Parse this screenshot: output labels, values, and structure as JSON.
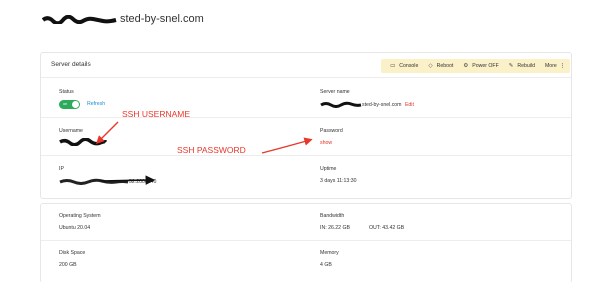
{
  "host": {
    "title_suffix": "sted-by-snel.com"
  },
  "details": {
    "title": "Server details",
    "toolbar": [
      {
        "label": "Console",
        "icon": "console-icon",
        "glyph": "▭"
      },
      {
        "label": "Reboot",
        "icon": "reboot-icon",
        "glyph": "◇"
      },
      {
        "label": "Power OFF",
        "icon": "power-icon",
        "glyph": "⚙"
      },
      {
        "label": "Rebuild",
        "icon": "wrench-icon",
        "glyph": "✎"
      },
      {
        "label": "More",
        "icon": "more-icon",
        "glyph": "⋮"
      }
    ],
    "status": {
      "label": "Status",
      "toggle_text": "on",
      "refresh": "Refresh"
    },
    "server_name": {
      "label": "Server name",
      "value_suffix": "sted-by-snel.com",
      "edit": "Edit"
    },
    "username": {
      "label": "Username"
    },
    "password": {
      "label": "Password",
      "show": "show"
    },
    "ip": {
      "label": "IP",
      "value_suffix": "52:2000::40"
    },
    "uptime": {
      "label": "Uptime",
      "value": "3 days 11:13:30"
    }
  },
  "stats": {
    "os": {
      "label": "Operating System",
      "value": "Ubuntu 20.04"
    },
    "bandwidth": {
      "label": "Bandwidth",
      "in": "IN: 26.22 GB",
      "out": "OUT: 43.42 GB"
    },
    "disk": {
      "label": "Disk Space",
      "value": "200 GB"
    },
    "memory": {
      "label": "Memory",
      "value": "4 GB"
    }
  },
  "annotations": {
    "ssh_username": "SSH USERNAME",
    "ssh_password": "SSH PASSWORD"
  },
  "colors": {
    "annotation": "#e8382b",
    "toggle_on": "#2eaa5c",
    "link": "#1a8fd6",
    "toolbar_bg": "#fbf1c8"
  }
}
